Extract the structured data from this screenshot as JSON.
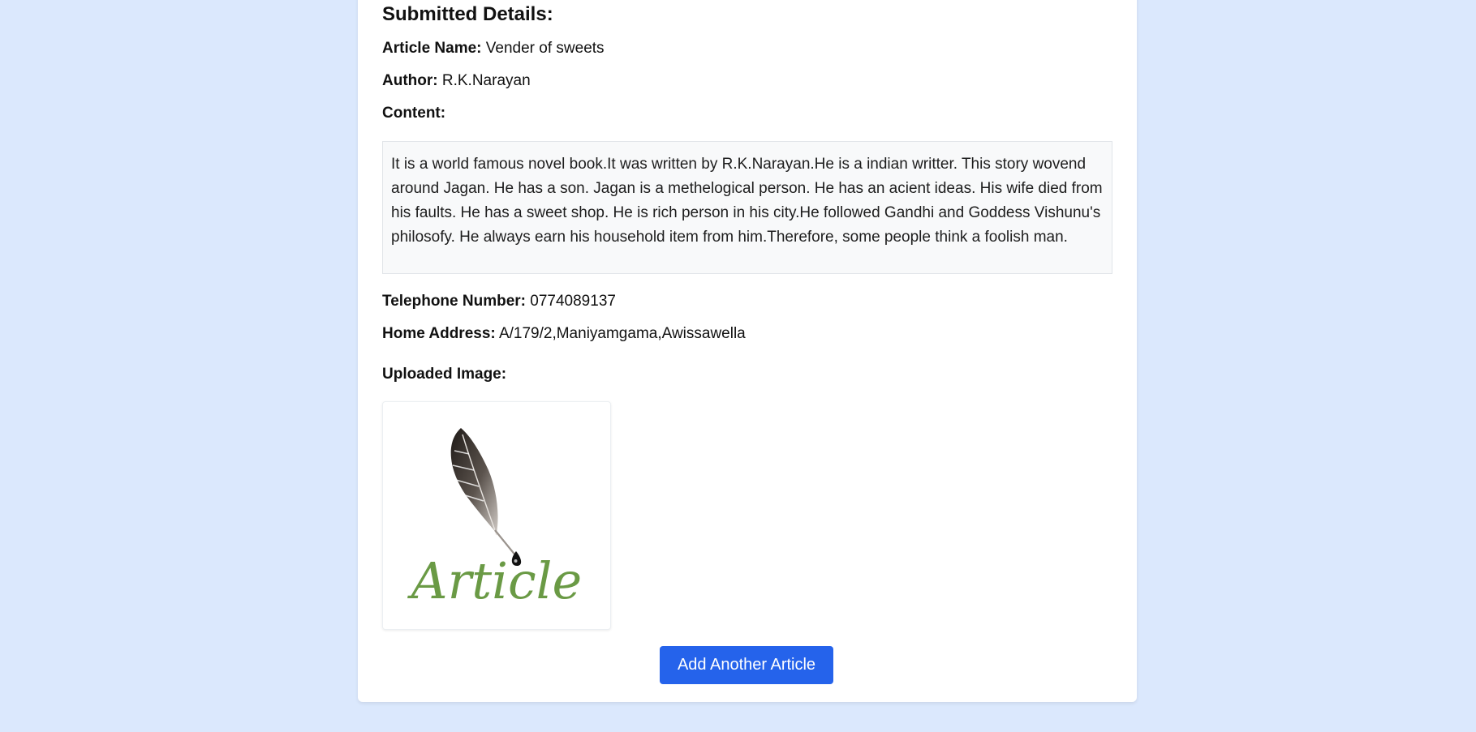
{
  "details": {
    "heading": "Submitted Details:",
    "article_name_label": "Article Name:",
    "article_name_value": "Vender of sweets",
    "author_label": "Author:",
    "author_value": "R.K.Narayan",
    "content_label": "Content:",
    "content_value": "It is a world famous novel book.It was written by R.K.Narayan.He is a indian writter. This story wovend around Jagan. He has a son. Jagan is a methelogical person. He has an acient ideas. His wife died from his faults. He has a sweet shop. He is rich person in his city.He followed Gandhi and Goddess Vishunu's philosofy. He always earn his household item from him.Therefore, some people think a foolish man.",
    "telephone_label": "Telephone Number:",
    "telephone_value": "0774089137",
    "address_label": "Home Address:",
    "address_value": "A/179/2,Maniyamgama,Awissawella",
    "image_label": "Uploaded Image:",
    "image_text": "Article",
    "image_icon": "quill-feather-icon"
  },
  "actions": {
    "add_another_label": "Add Another Article"
  },
  "colors": {
    "page_background": "#dbe8fd",
    "button_primary": "#2563eb",
    "logo_text_green": "#6a9a45"
  }
}
